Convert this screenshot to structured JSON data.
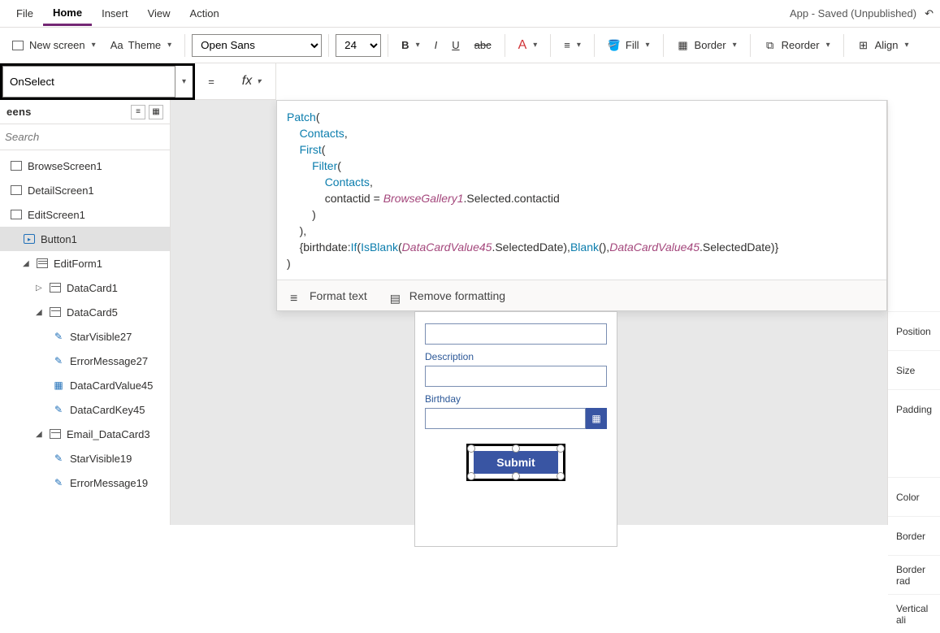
{
  "header": {
    "save_status": "App - Saved (Unpublished)",
    "menus": {
      "file": "File",
      "home": "Home",
      "insert": "Insert",
      "view": "View",
      "action": "Action"
    }
  },
  "ribbon": {
    "new_screen": "New screen",
    "theme": "Theme",
    "font": "Open Sans",
    "font_size": "24",
    "fill": "Fill",
    "border": "Border",
    "reorder": "Reorder",
    "align": "Align"
  },
  "property_dropdown": {
    "selected": "OnSelect",
    "equals": "=",
    "fx": "fx"
  },
  "tree": {
    "header": "eens",
    "search_placeholder": "Search",
    "items": [
      {
        "label": "BrowseScreen1",
        "icon": "screen",
        "indent": 1
      },
      {
        "label": "DetailScreen1",
        "icon": "screen",
        "indent": 1
      },
      {
        "label": "EditScreen1",
        "icon": "screen",
        "indent": 1
      },
      {
        "label": "Button1",
        "icon": "button",
        "indent": 2,
        "selected": true
      },
      {
        "label": "EditForm1",
        "icon": "form",
        "indent": 2,
        "expander": "▢"
      },
      {
        "label": "DataCard1",
        "icon": "card",
        "indent": 3,
        "expander": "▷"
      },
      {
        "label": "DataCard5",
        "icon": "card",
        "indent": 3,
        "expander": "▢"
      },
      {
        "label": "StarVisible27",
        "icon": "pencil",
        "indent": 4
      },
      {
        "label": "ErrorMessage27",
        "icon": "pencil",
        "indent": 4
      },
      {
        "label": "DataCardValue45",
        "icon": "calendar",
        "indent": 4
      },
      {
        "label": "DataCardKey45",
        "icon": "pencil",
        "indent": 4
      },
      {
        "label": "Email_DataCard3",
        "icon": "card",
        "indent": 3,
        "expander": "▢"
      },
      {
        "label": "StarVisible19",
        "icon": "pencil",
        "indent": 4
      },
      {
        "label": "ErrorMessage19",
        "icon": "pencil",
        "indent": 4
      }
    ]
  },
  "formula": {
    "line1_fn": "Patch",
    "line1_rest": "(",
    "line2_ds": "Contacts",
    "line2_rest": ",",
    "line3_fn": "First",
    "line3_rest": "(",
    "line4_fn": "Filter",
    "line4_rest": "(",
    "line5_ds": "Contacts",
    "line5_rest": ",",
    "line6_pre": "contactid = ",
    "line6_var": "BrowseGallery1",
    "line6_post": ".Selected.contactid",
    "line7": ")",
    "line8": "),",
    "line9_pre": "{birthdate:",
    "line9_fn1": "If",
    "line9_mid1": "(",
    "line9_fn2": "IsBlank",
    "line9_mid2": "(",
    "line9_var1": "DataCardValue45",
    "line9_mid3": ".SelectedDate),",
    "line9_fn3": "Blank",
    "line9_mid4": "(),",
    "line9_var2": "DataCardValue45",
    "line9_post": ".SelectedDate)}",
    "line10": ")"
  },
  "format_bar": {
    "format": "Format text",
    "remove": "Remove formatting"
  },
  "canvas": {
    "description_label": "Description",
    "birthday_label": "Birthday",
    "submit_label": "Submit"
  },
  "right": {
    "position": "Position",
    "size": "Size",
    "padding": "Padding",
    "color": "Color",
    "border": "Border",
    "border_radius": "Border rad",
    "vertical_align": "Vertical ali"
  }
}
